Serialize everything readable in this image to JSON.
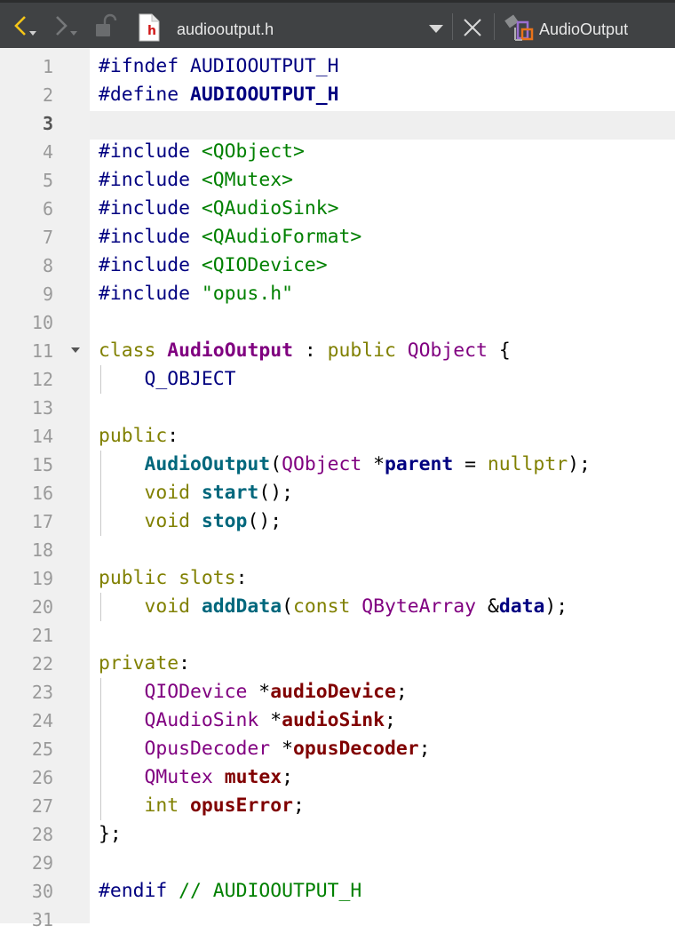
{
  "toolbar": {
    "file_name": "audiooutput.h",
    "file_icon_letter": "h",
    "symbol_name": "AudioOutput",
    "icons": [
      "back-icon",
      "forward-icon",
      "lock-icon",
      "header-file-icon",
      "dropdown-icon",
      "close-icon",
      "class-symbol-icon"
    ],
    "accent_color": "#f5c518"
  },
  "editor": {
    "current_line": 3,
    "colors": {
      "preprocessor": "#000080",
      "string": "#008000",
      "keyword": "#808000",
      "type": "#800080",
      "function": "#00677c",
      "field": "#800000",
      "gutter": "#f0f0f0",
      "current_line": "#efefef"
    },
    "lines": [
      {
        "n": "1",
        "tokens": [
          [
            "pp",
            "#ifndef"
          ],
          [
            "p",
            " "
          ],
          [
            "ppid",
            "AUDIOOUTPUT_H"
          ]
        ]
      },
      {
        "n": "2",
        "tokens": [
          [
            "pp",
            "#define"
          ],
          [
            "p",
            " "
          ],
          [
            "ppidb",
            "AUDIOOUTPUT_H"
          ]
        ]
      },
      {
        "n": "3",
        "tokens": []
      },
      {
        "n": "4",
        "tokens": [
          [
            "pp",
            "#include"
          ],
          [
            "p",
            " "
          ],
          [
            "str",
            "<QObject>"
          ]
        ]
      },
      {
        "n": "5",
        "tokens": [
          [
            "pp",
            "#include"
          ],
          [
            "p",
            " "
          ],
          [
            "str",
            "<QMutex>"
          ]
        ]
      },
      {
        "n": "6",
        "tokens": [
          [
            "pp",
            "#include"
          ],
          [
            "p",
            " "
          ],
          [
            "str",
            "<QAudioSink>"
          ]
        ]
      },
      {
        "n": "7",
        "tokens": [
          [
            "pp",
            "#include"
          ],
          [
            "p",
            " "
          ],
          [
            "str",
            "<QAudioFormat>"
          ]
        ]
      },
      {
        "n": "8",
        "tokens": [
          [
            "pp",
            "#include"
          ],
          [
            "p",
            " "
          ],
          [
            "str",
            "<QIODevice>"
          ]
        ]
      },
      {
        "n": "9",
        "tokens": [
          [
            "pp",
            "#include"
          ],
          [
            "p",
            " "
          ],
          [
            "str",
            "\"opus.h\""
          ]
        ]
      },
      {
        "n": "10",
        "tokens": []
      },
      {
        "n": "11",
        "fold": true,
        "tokens": [
          [
            "kw",
            "class"
          ],
          [
            "p",
            " "
          ],
          [
            "cls",
            "AudioOutput"
          ],
          [
            "p",
            " : "
          ],
          [
            "kw",
            "public"
          ],
          [
            "p",
            " "
          ],
          [
            "typ",
            "QObject"
          ],
          [
            "p",
            " {"
          ]
        ]
      },
      {
        "n": "12",
        "tokens": [
          [
            "p",
            "    "
          ],
          [
            "mac",
            "Q_OBJECT"
          ]
        ]
      },
      {
        "n": "13",
        "tokens": []
      },
      {
        "n": "14",
        "tokens": [
          [
            "kw",
            "public"
          ],
          [
            "p",
            ":"
          ]
        ]
      },
      {
        "n": "15",
        "tokens": [
          [
            "p",
            "    "
          ],
          [
            "fn",
            "AudioOutput"
          ],
          [
            "p",
            "("
          ],
          [
            "typ",
            "QObject"
          ],
          [
            "p",
            " *"
          ],
          [
            "par",
            "parent"
          ],
          [
            "p",
            " = "
          ],
          [
            "kw",
            "nullptr"
          ],
          [
            "p",
            ");"
          ]
        ]
      },
      {
        "n": "16",
        "tokens": [
          [
            "p",
            "    "
          ],
          [
            "kw",
            "void"
          ],
          [
            "p",
            " "
          ],
          [
            "fn",
            "start"
          ],
          [
            "p",
            "();"
          ]
        ]
      },
      {
        "n": "17",
        "tokens": [
          [
            "p",
            "    "
          ],
          [
            "kw",
            "void"
          ],
          [
            "p",
            " "
          ],
          [
            "fn",
            "stop"
          ],
          [
            "p",
            "();"
          ]
        ]
      },
      {
        "n": "18",
        "tokens": []
      },
      {
        "n": "19",
        "tokens": [
          [
            "kw",
            "public"
          ],
          [
            "p",
            " "
          ],
          [
            "kw",
            "slots"
          ],
          [
            "p",
            ":"
          ]
        ]
      },
      {
        "n": "20",
        "tokens": [
          [
            "p",
            "    "
          ],
          [
            "kw",
            "void"
          ],
          [
            "p",
            " "
          ],
          [
            "fn",
            "addData"
          ],
          [
            "p",
            "("
          ],
          [
            "kw",
            "const"
          ],
          [
            "p",
            " "
          ],
          [
            "typ",
            "QByteArray"
          ],
          [
            "p",
            " &"
          ],
          [
            "par",
            "data"
          ],
          [
            "p",
            ");"
          ]
        ]
      },
      {
        "n": "21",
        "tokens": []
      },
      {
        "n": "22",
        "tokens": [
          [
            "kw",
            "private"
          ],
          [
            "p",
            ":"
          ]
        ]
      },
      {
        "n": "23",
        "tokens": [
          [
            "p",
            "    "
          ],
          [
            "typ",
            "QIODevice"
          ],
          [
            "p",
            " *"
          ],
          [
            "fld",
            "audioDevice"
          ],
          [
            "p",
            ";"
          ]
        ]
      },
      {
        "n": "24",
        "tokens": [
          [
            "p",
            "    "
          ],
          [
            "typ",
            "QAudioSink"
          ],
          [
            "p",
            " *"
          ],
          [
            "fld",
            "audioSink"
          ],
          [
            "p",
            ";"
          ]
        ]
      },
      {
        "n": "25",
        "tokens": [
          [
            "p",
            "    "
          ],
          [
            "typ",
            "OpusDecoder"
          ],
          [
            "p",
            " *"
          ],
          [
            "fld",
            "opusDecoder"
          ],
          [
            "p",
            ";"
          ]
        ]
      },
      {
        "n": "26",
        "tokens": [
          [
            "p",
            "    "
          ],
          [
            "typ",
            "QMutex"
          ],
          [
            "p",
            " "
          ],
          [
            "fld",
            "mutex"
          ],
          [
            "p",
            ";"
          ]
        ]
      },
      {
        "n": "27",
        "tokens": [
          [
            "p",
            "    "
          ],
          [
            "kw",
            "int"
          ],
          [
            "p",
            " "
          ],
          [
            "fld",
            "opusError"
          ],
          [
            "p",
            ";"
          ]
        ]
      },
      {
        "n": "28",
        "tokens": [
          [
            "p",
            "};"
          ]
        ]
      },
      {
        "n": "29",
        "tokens": []
      },
      {
        "n": "30",
        "tokens": [
          [
            "pp",
            "#endif"
          ],
          [
            "p",
            " "
          ],
          [
            "com",
            "// AUDIOOUTPUT_H"
          ]
        ]
      },
      {
        "n": "31",
        "tokens": []
      }
    ]
  }
}
